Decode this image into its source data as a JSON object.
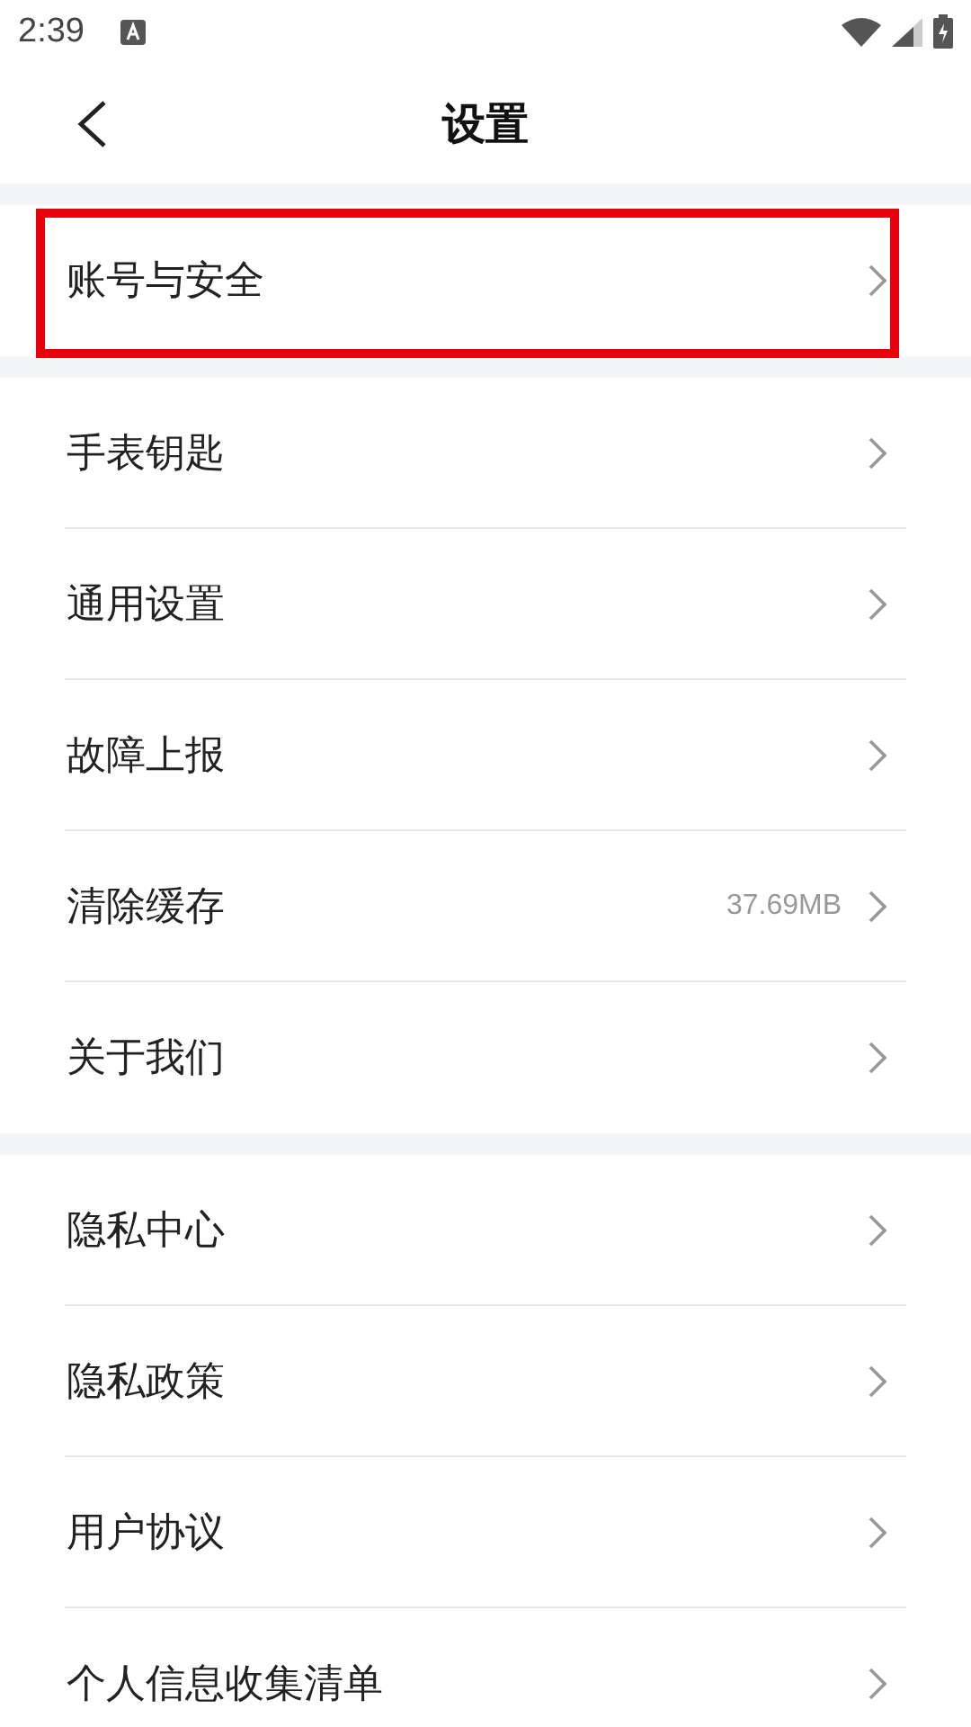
{
  "status_bar": {
    "time": "2:39"
  },
  "header": {
    "title": "设置"
  },
  "groups": [
    {
      "items": [
        {
          "label": "账号与安全",
          "highlighted": true
        }
      ]
    },
    {
      "items": [
        {
          "label": "手表钥匙",
          "highlighted": false
        },
        {
          "label": "通用设置",
          "highlighted": false
        },
        {
          "label": "故障上报",
          "highlighted": false
        },
        {
          "label": "清除缓存",
          "value": "37.69MB",
          "highlighted": false
        },
        {
          "label": "关于我们",
          "highlighted": false
        }
      ]
    },
    {
      "items": [
        {
          "label": "隐私中心",
          "highlighted": false
        },
        {
          "label": "隐私政策",
          "highlighted": false
        },
        {
          "label": "用户协议",
          "highlighted": false
        },
        {
          "label": "个人信息收集清单",
          "highlighted": false
        }
      ]
    }
  ]
}
